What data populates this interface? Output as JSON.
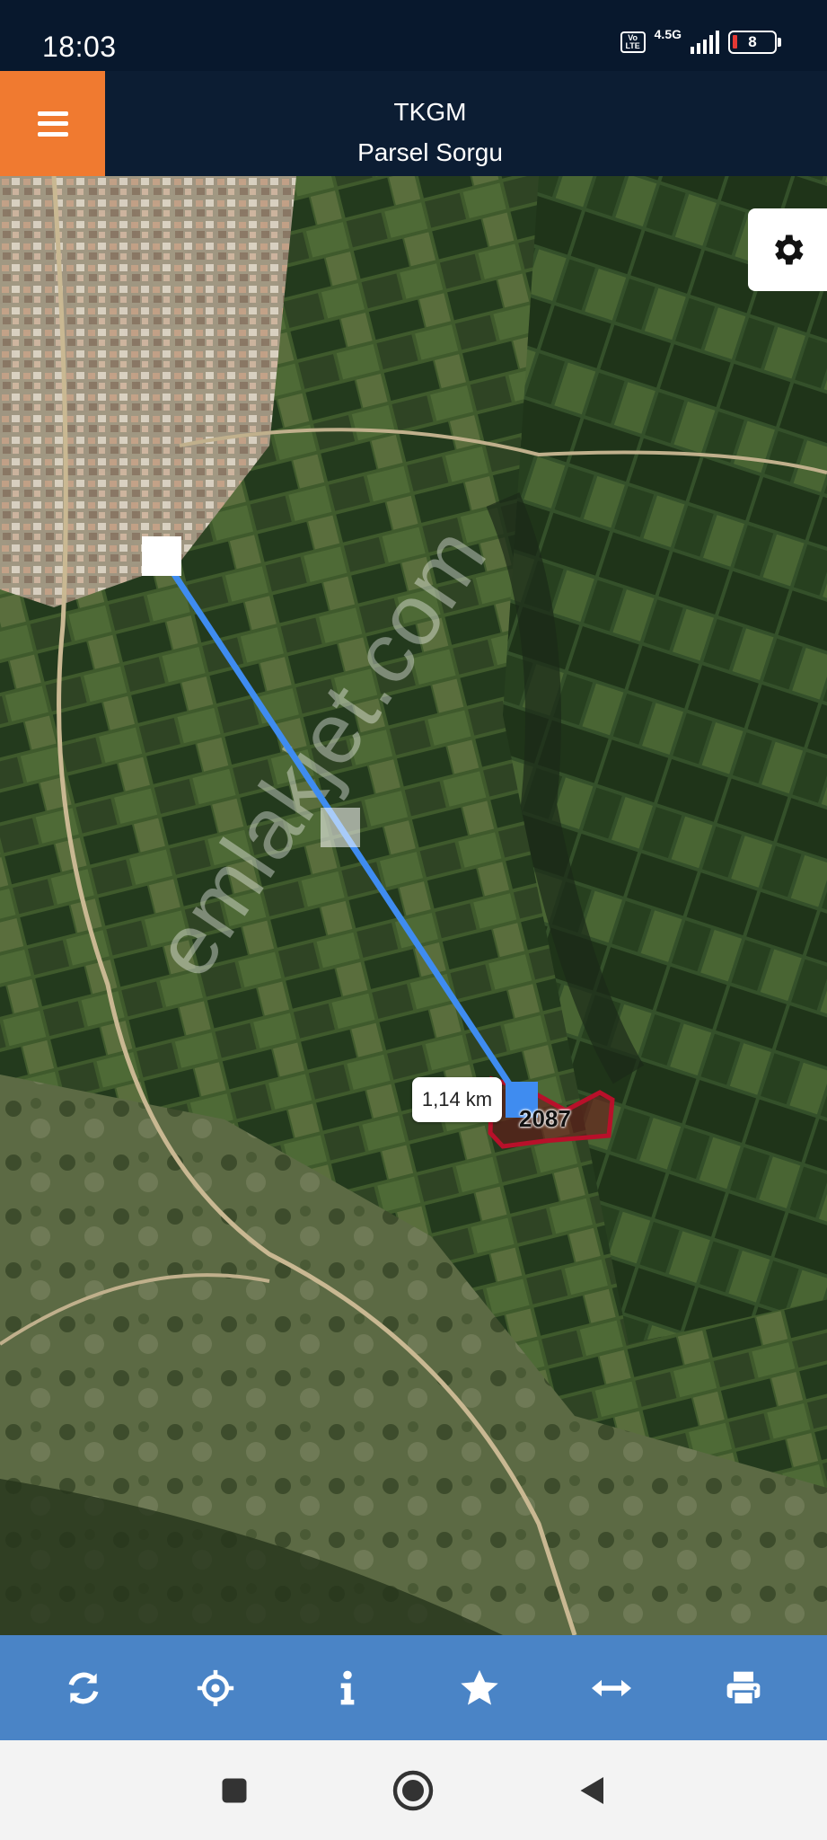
{
  "status_bar": {
    "time": "18:03",
    "volte": "Vo LTE",
    "network": "4.5G",
    "battery": "8"
  },
  "header": {
    "title": "TKGM",
    "subtitle": "Parsel Sorgu",
    "accent_color": "#f07a30",
    "background_color": "#0c1d33"
  },
  "map": {
    "distance_label": "1,14 km",
    "parcel_number": "2087",
    "watermark": "emlakjet.com",
    "measure_line_color": "#3f8cf0",
    "parcel_outline_color": "#b8102a"
  },
  "toolbar": {
    "background_color": "#4a84c6",
    "tools": [
      "refresh-icon",
      "locate-icon",
      "info-icon",
      "star-icon",
      "measure-icon",
      "print-icon"
    ]
  },
  "nav_bar": {
    "buttons": [
      "recents-icon",
      "home-icon",
      "back-icon"
    ]
  }
}
